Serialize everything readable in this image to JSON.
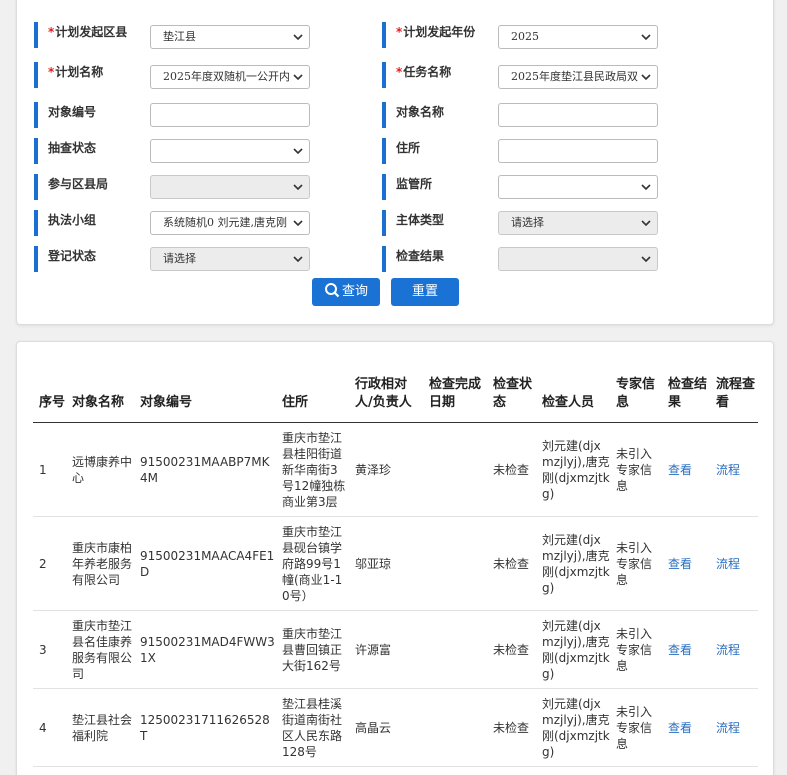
{
  "form": {
    "plan_county": {
      "label": "计划发起区县",
      "required": true,
      "value": "垫江县"
    },
    "plan_year": {
      "label": "计划发起年份",
      "required": true,
      "value": "2025"
    },
    "plan_name": {
      "label": "计划名称",
      "required": true,
      "value": "2025年度双随机一公开内"
    },
    "task_name": {
      "label": "任务名称",
      "required": true,
      "value": "2025年度垫江县民政局双"
    },
    "object_code": {
      "label": "对象编号",
      "value": ""
    },
    "object_name": {
      "label": "对象名称",
      "value": ""
    },
    "inspect_status": {
      "label": "抽查状态",
      "value": ""
    },
    "address": {
      "label": "住所",
      "value": ""
    },
    "participating_county": {
      "label": "参与区县局",
      "value": ""
    },
    "supervision_office": {
      "label": "监管所",
      "value": ""
    },
    "law_team": {
      "label": "执法小组",
      "value": "系统随机0   刘元建,唐克刚"
    },
    "entity_type": {
      "label": "主体类型",
      "value": "请选择"
    },
    "register_status": {
      "label": "登记状态",
      "value": "请选择"
    },
    "check_result": {
      "label": "检查结果",
      "value": ""
    }
  },
  "buttons": {
    "query": "查询",
    "reset": "重置"
  },
  "table": {
    "headers": {
      "seq": "序号",
      "name": "对象名称",
      "code": "对象编号",
      "addr": "住所",
      "person": "行政相对人/负责人",
      "date": "检查完成日期",
      "status": "检查状态",
      "inspector": "检查人员",
      "expert": "专家信息",
      "result": "检查结果",
      "flow": "流程查看"
    },
    "rows": [
      {
        "seq": "1",
        "name": "远博康养中心",
        "code": "91500231MAABP7MK4M",
        "addr": "重庆市垫江县桂阳街道新华南街3号12幢独栋商业第3层",
        "person": "黄泽珍",
        "date": "",
        "status": "未检查",
        "inspector": "刘元建(djxmzjlyj),唐克刚(djxmzjtkg)",
        "expert": "未引入专家信息",
        "result": "查看",
        "flow": "流程"
      },
      {
        "seq": "2",
        "name": "重庆市康柏年养老服务有限公司",
        "code": "91500231MAACA4FE1D",
        "addr": "重庆市垫江县砚台镇学府路99号1幢(商业1-10号）",
        "person": "邬亚琼",
        "date": "",
        "status": "未检查",
        "inspector": "刘元建(djxmzjlyj),唐克刚(djxmzjtkg)",
        "expert": "未引入专家信息",
        "result": "查看",
        "flow": "流程"
      },
      {
        "seq": "3",
        "name": "重庆市垫江县名佳康养服务有限公司",
        "code": "91500231MAD4FWW31X",
        "addr": "重庆市垫江县曹回镇正大街162号",
        "person": "许源富",
        "date": "",
        "status": "未检查",
        "inspector": "刘元建(djxmzjlyj),唐克刚(djxmzjtkg)",
        "expert": "未引入专家信息",
        "result": "查看",
        "flow": "流程"
      },
      {
        "seq": "4",
        "name": "垫江县社会福利院",
        "code": "12500231711626528T",
        "addr": "垫江县桂溪街道南街社区人民东路128号",
        "person": "高晶云",
        "date": "",
        "status": "未检查",
        "inspector": "刘元建(djxmzjlyj),唐克刚(djxmzjtkg)",
        "expert": "未引入专家信息",
        "result": "查看",
        "flow": "流程"
      }
    ]
  },
  "colors": {
    "accent": "#1a73d4",
    "required": "#e02020",
    "link": "#2a6fc0"
  }
}
